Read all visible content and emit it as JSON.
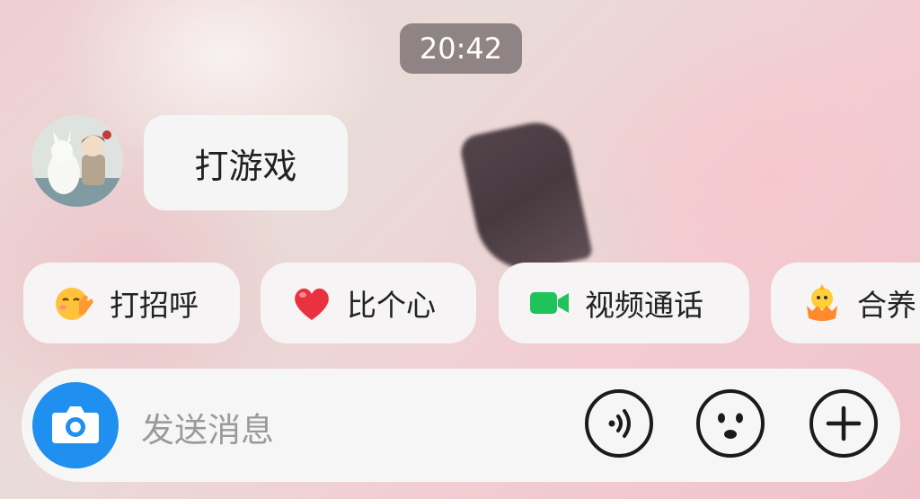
{
  "status": {
    "time": "20:42"
  },
  "chat": {
    "message": "打游戏"
  },
  "quick_actions": [
    {
      "label": "打招呼",
      "icon": "wave-hand-emoji-icon"
    },
    {
      "label": "比个心",
      "icon": "heart-icon"
    },
    {
      "label": "视频通话",
      "icon": "video-camera-icon"
    },
    {
      "label": "合养",
      "icon": "chick-egg-icon"
    }
  ],
  "composer": {
    "placeholder": "发送消息",
    "buttons": [
      "camera-icon",
      "voice-icon",
      "emoji-icon",
      "plus-icon"
    ]
  },
  "colors": {
    "camera_button": "#1f8ff0",
    "video_icon": "#20c25a",
    "heart": "#e8323f"
  }
}
